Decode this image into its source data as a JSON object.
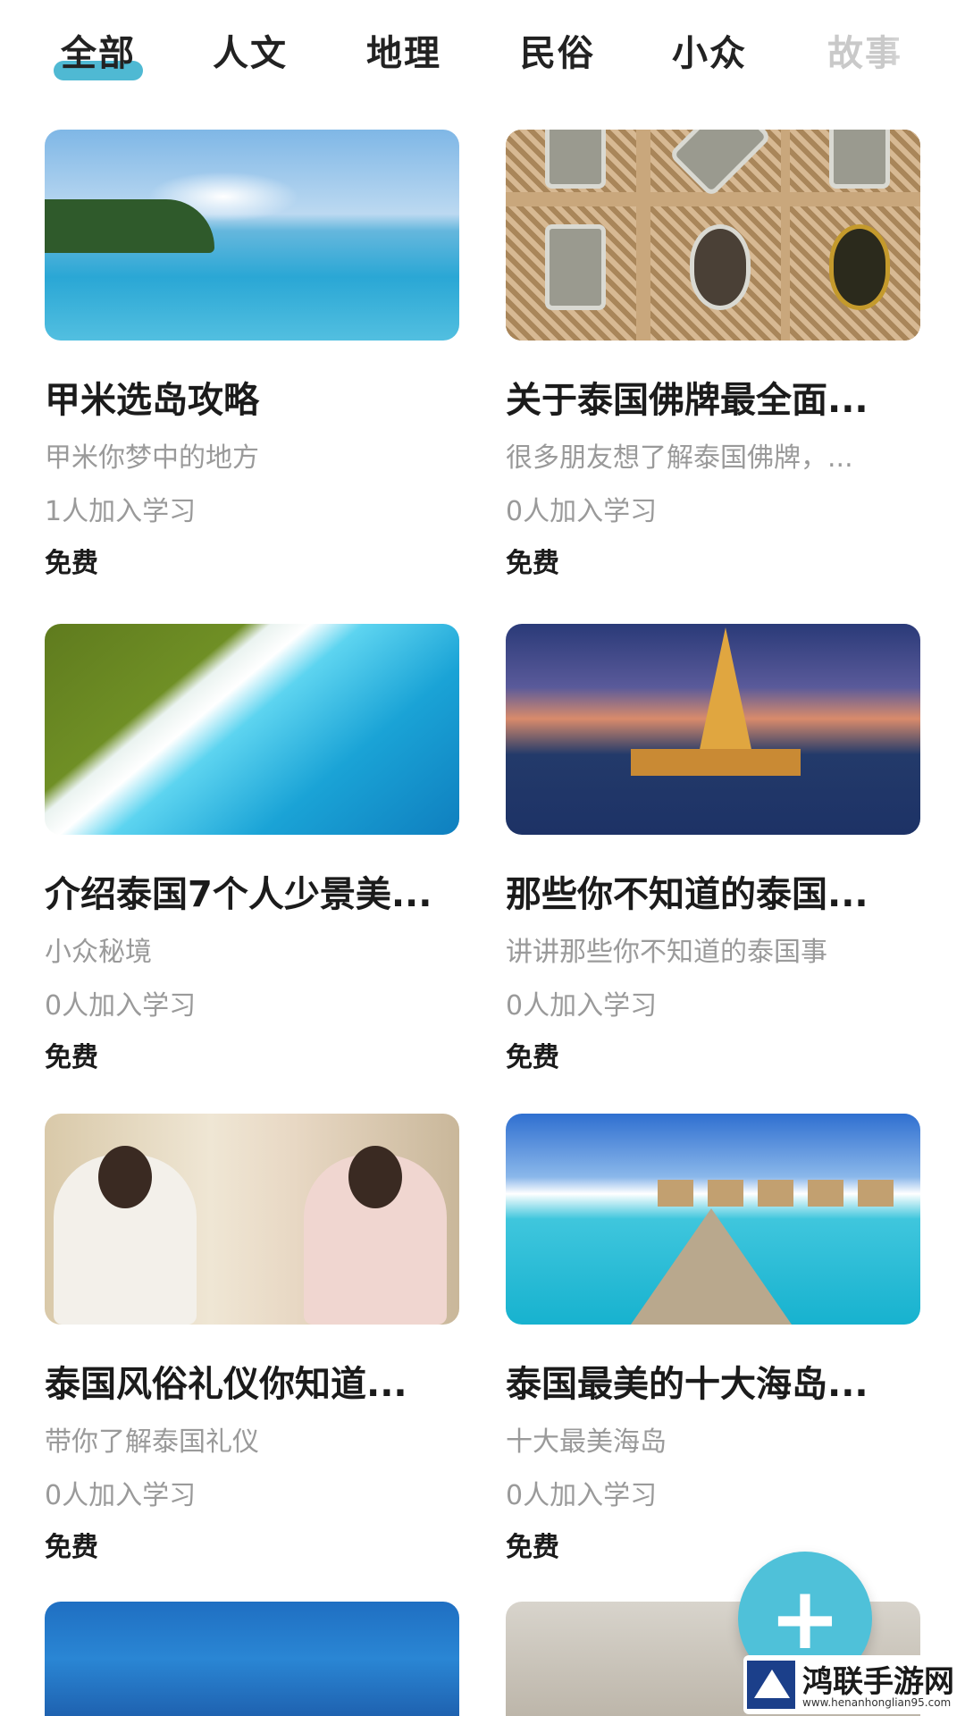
{
  "tabs": [
    {
      "label": "全部"
    },
    {
      "label": "人文"
    },
    {
      "label": "地理"
    },
    {
      "label": "民俗"
    },
    {
      "label": "小众"
    },
    {
      "label": "故事"
    }
  ],
  "cards": [
    {
      "title": "甲米选岛攻略",
      "subtitle": "甲米你梦中的地方",
      "learners": "1人加入学习",
      "price": "免费",
      "image": "sea-island"
    },
    {
      "title": "关于泰国佛牌最全面...",
      "subtitle": "很多朋友想了解泰国佛牌，...",
      "learners": "0人加入学习",
      "price": "免费",
      "image": "amulets"
    },
    {
      "title": "介绍泰国7个人少景美...",
      "subtitle": "小众秘境",
      "learners": "0人加入学习",
      "price": "免费",
      "image": "beach-aerial"
    },
    {
      "title": "那些你不知道的泰国...",
      "subtitle": "讲讲那些你不知道的泰国事",
      "learners": "0人加入学习",
      "price": "免费",
      "image": "temple"
    },
    {
      "title": "泰国风俗礼仪你知道...",
      "subtitle": "带你了解泰国礼仪",
      "learners": "0人加入学习",
      "price": "免费",
      "image": "thai-women"
    },
    {
      "title": "泰国最美的十大海岛...",
      "subtitle": "十大最美海岛",
      "learners": "0人加入学习",
      "price": "免费",
      "image": "overwater-villas"
    }
  ],
  "fab": {
    "label": "+",
    "icon": "plus-icon"
  },
  "watermark": {
    "name": "鸿联手游网",
    "url": "www.henanhonglian95.com"
  },
  "colors": {
    "accent": "#4fb9d3",
    "fab": "#4fc1d9"
  }
}
